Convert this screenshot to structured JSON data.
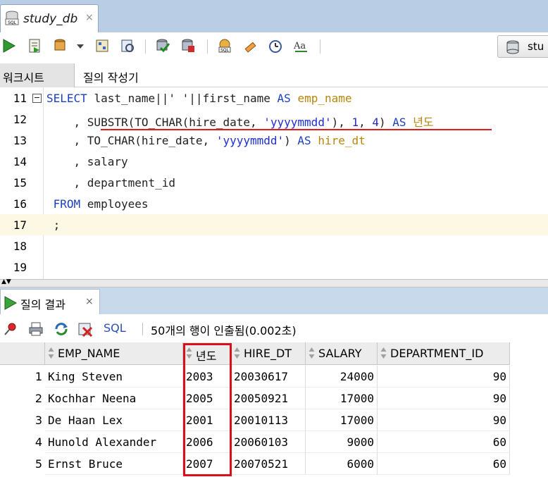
{
  "window": {
    "doc_tab_title": "study_db",
    "doc_tab_close": "×",
    "connection_label": "stu"
  },
  "toolbar": {
    "icons": [
      "run-statement-icon",
      "run-script-icon",
      "autotrace-icon",
      "dropdown-arrow-icon",
      "explain-plan-icon",
      "sql-tuning-icon",
      "commit-icon",
      "rollback-icon",
      "unshared-sql-icon",
      "clear-icon",
      "sql-history-icon",
      "format-icon"
    ]
  },
  "subtabs": {
    "worksheet": "워크시트",
    "query_builder": "질의 작성기"
  },
  "editor": {
    "lines": [
      {
        "no": "11",
        "segments": [
          [
            "kw",
            "SELECT "
          ],
          [
            "txt",
            "last_name||' '||first_name "
          ],
          [
            "kw",
            "AS "
          ],
          [
            "alias",
            "emp_name"
          ]
        ]
      },
      {
        "no": "12",
        "segments": [
          [
            "txt",
            "    , SUBSTR(TO_CHAR(hire_date, "
          ],
          [
            "str",
            "'yyyymmdd'"
          ],
          [
            "txt",
            "), "
          ],
          [
            "num",
            "1"
          ],
          [
            "txt",
            ", "
          ],
          [
            "num",
            "4"
          ],
          [
            "txt",
            ") "
          ],
          [
            "kw",
            "AS "
          ],
          [
            "alias",
            "년도"
          ]
        ]
      },
      {
        "no": "13",
        "segments": [
          [
            "txt",
            "    , TO_CHAR(hire_date, "
          ],
          [
            "str",
            "'yyyymmdd'"
          ],
          [
            "txt",
            ") "
          ],
          [
            "kw",
            "AS "
          ],
          [
            "alias",
            "hire_dt"
          ]
        ]
      },
      {
        "no": "14",
        "segments": [
          [
            "txt",
            "    , salary"
          ]
        ]
      },
      {
        "no": "15",
        "segments": [
          [
            "txt",
            "    , department_id"
          ]
        ]
      },
      {
        "no": "16",
        "segments": [
          [
            "kw",
            " FROM "
          ],
          [
            "txt",
            "employees"
          ]
        ]
      },
      {
        "no": "17",
        "segments": [
          [
            "txt",
            " ;"
          ]
        ]
      },
      {
        "no": "18",
        "segments": []
      },
      {
        "no": "19",
        "segments": []
      }
    ],
    "fold_symbol": "−",
    "highlighted_line": "17"
  },
  "results": {
    "tab_label": "질의 결과",
    "tab_close": "×",
    "sql_link": "SQL",
    "status": "50개의 행이 인출됨(0.002초)",
    "columns": [
      "EMP_NAME",
      "년도",
      "HIRE_DT",
      "SALARY",
      "DEPARTMENT_ID"
    ],
    "rows": [
      {
        "n": "1",
        "emp_name": "King Steven",
        "year": "2003",
        "hire_dt": "20030617",
        "salary": "24000",
        "dept": "90"
      },
      {
        "n": "2",
        "emp_name": "Kochhar Neena",
        "year": "2005",
        "hire_dt": "20050921",
        "salary": "17000",
        "dept": "90"
      },
      {
        "n": "3",
        "emp_name": "De Haan Lex",
        "year": "2001",
        "hire_dt": "20010113",
        "salary": "17000",
        "dept": "90"
      },
      {
        "n": "4",
        "emp_name": "Hunold Alexander",
        "year": "2006",
        "hire_dt": "20060103",
        "salary": "9000",
        "dept": "60"
      },
      {
        "n": "5",
        "emp_name": "Ernst Bruce",
        "year": "2007",
        "hire_dt": "20070521",
        "salary": "6000",
        "dept": "60"
      }
    ]
  },
  "colors": {
    "keyword": "#1c3fbf",
    "alias": "#b8860b",
    "annotation_red": "#d8101a"
  }
}
